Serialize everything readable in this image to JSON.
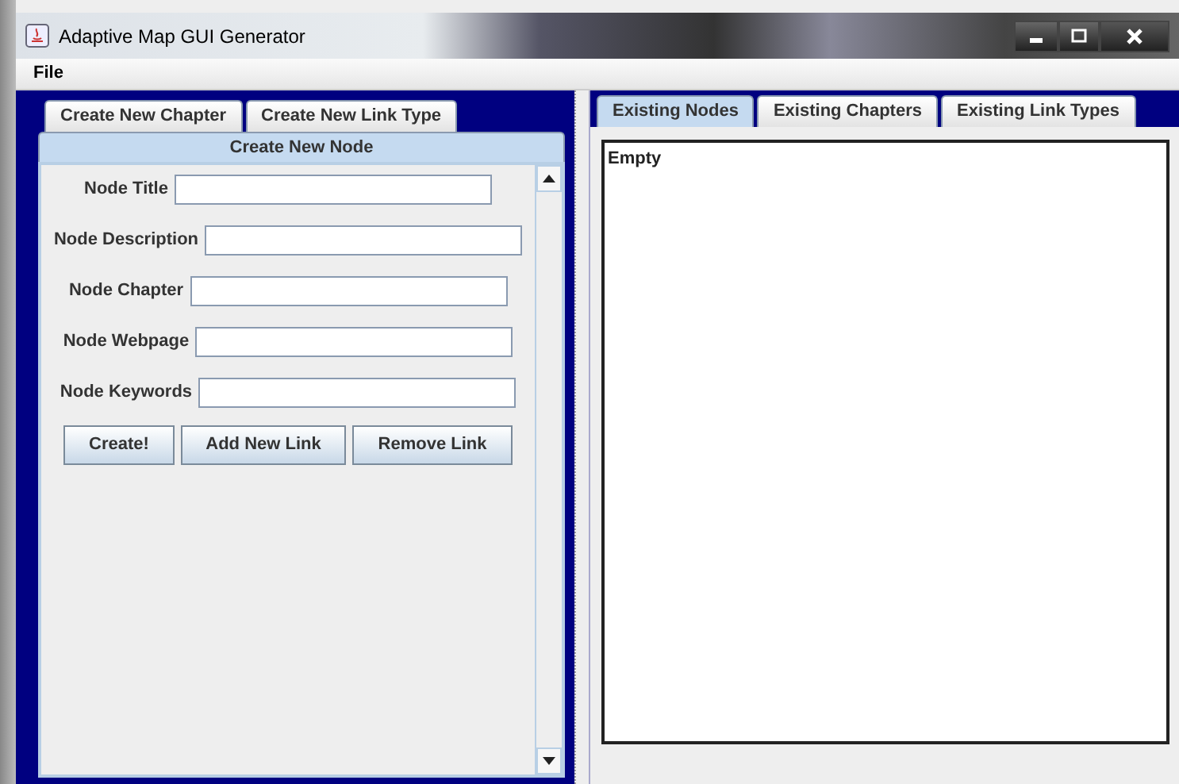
{
  "window": {
    "title": "Adaptive Map GUI Generator"
  },
  "menu": [
    "File"
  ],
  "left_tabs": [
    {
      "label": "Create New Chapter",
      "selected": false
    },
    {
      "label": "Create New Link Type",
      "selected": false
    },
    {
      "label": "Create New Node",
      "selected": true
    }
  ],
  "form": {
    "fields": [
      {
        "label": "Node Title"
      },
      {
        "label": "Node Description"
      },
      {
        "label": "Node Chapter"
      },
      {
        "label": "Node Webpage"
      },
      {
        "label": "Node Keywords"
      }
    ],
    "buttons": [
      "Create!",
      "Add New Link",
      "Remove Link"
    ]
  },
  "right_tabs": [
    {
      "label": "Existing Nodes",
      "selected": true
    },
    {
      "label": "Existing Chapters",
      "selected": false
    },
    {
      "label": "Existing Link Types",
      "selected": false
    }
  ],
  "list": {
    "text": "Empty"
  }
}
